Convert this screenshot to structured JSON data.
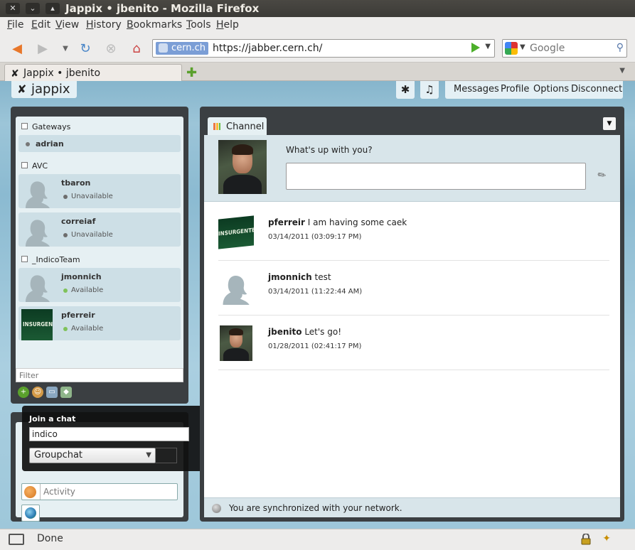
{
  "window": {
    "title": "Jappix • jbenito - Mozilla Firefox"
  },
  "menu": [
    "File",
    "Edit",
    "View",
    "History",
    "Bookmarks",
    "Tools",
    "Help"
  ],
  "nav": {
    "site_identity": "cern.ch",
    "url": "https://jabber.cern.ch/",
    "search_placeholder": "Google"
  },
  "tabs": [
    {
      "label": "Jappix • jbenito"
    }
  ],
  "app": {
    "logo_text": "jappix",
    "top_menu": [
      "Messages",
      "Profile",
      "Options",
      "Disconnect"
    ]
  },
  "roster": {
    "groups": [
      {
        "name": "Gateways",
        "buddies": [
          {
            "name": "adrian",
            "status": ""
          }
        ]
      },
      {
        "name": "AVC",
        "buddies": [
          {
            "name": "tbaron",
            "status": "Unavailable"
          },
          {
            "name": "correiaf",
            "status": "Unavailable"
          }
        ]
      },
      {
        "name": "_IndicoTeam",
        "buddies": [
          {
            "name": "jmonnich",
            "status": "Available"
          },
          {
            "name": "pferreir",
            "status": "Available"
          }
        ]
      }
    ],
    "filter_placeholder": "Filter"
  },
  "join_chat": {
    "title": "Join a chat",
    "input_value": "indico",
    "type_value": "Groupchat"
  },
  "activity_placeholder": "Activity",
  "channel": {
    "tab_label": "Channel",
    "prompt": "What's up with you?",
    "posts": [
      {
        "author": "pferreir",
        "text": "I am having some caek",
        "time": "03/14/2011 (03:09:17 PM)"
      },
      {
        "author": "jmonnich",
        "text": "test",
        "time": "03/14/2011 (11:22:44 AM)"
      },
      {
        "author": "jbenito",
        "text": "Let's go!",
        "time": "01/28/2011 (02:41:17 PM)"
      }
    ],
    "footer": "You are synchronized with your network."
  },
  "avatar_sign_text": "INSURGENTE",
  "status_bar": {
    "text": "Done"
  },
  "colors": {
    "available": "#7fc25a",
    "unavailable": "#6d6d6d",
    "panel_dark": "#3b3f42",
    "panel_light": "#e6f0f3"
  }
}
